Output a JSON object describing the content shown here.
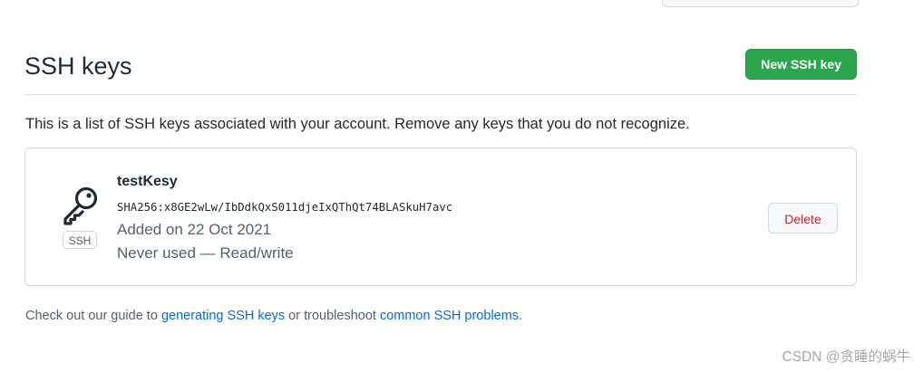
{
  "section": {
    "title": "SSH keys",
    "new_key_button": "New SSH key",
    "intro": "This is a list of SSH keys associated with your account. Remove any keys that you do not recognize."
  },
  "keys": [
    {
      "name": "testKesy",
      "fingerprint": "SHA256:x8GE2wLw/IbDdkQxS011djeIxQThQt74BLASkuH7avc",
      "added": "Added on 22 Oct 2021",
      "usage": "Never used — Read/write",
      "type_badge": "SSH",
      "icon": "key-icon",
      "delete_label": "Delete"
    }
  ],
  "footer": {
    "prefix": "Check out our guide to ",
    "link1": "generating SSH keys",
    "middle": " or troubleshoot ",
    "link2": "common SSH problems",
    "suffix": "."
  },
  "watermark": "CSDN @贪睡的蜗牛",
  "colors": {
    "primary_button": "#2da44e",
    "danger_text": "#cf222e",
    "link": "#0969da"
  }
}
